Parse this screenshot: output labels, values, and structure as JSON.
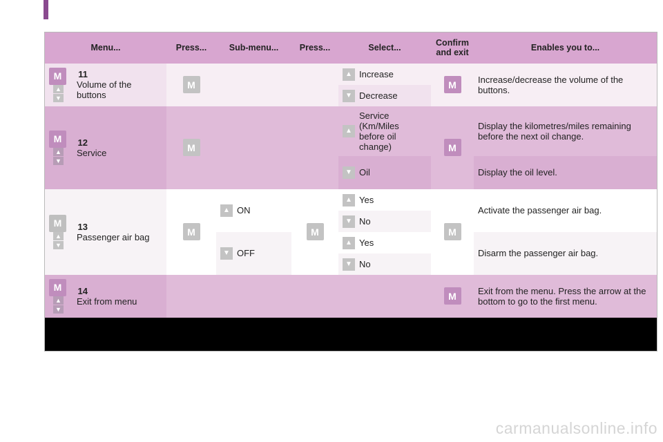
{
  "header": {
    "menu": "Menu...",
    "press1": "Press...",
    "submenu": "Sub-menu...",
    "press2": "Press...",
    "select": "Select...",
    "confirm": "Confirm and exit",
    "enables": "Enables you to..."
  },
  "btn_M": "M",
  "rows": {
    "r11": {
      "num": "11",
      "menu": "Volume of the buttons",
      "sel_up": "Increase",
      "sel_dn": "Decrease",
      "enables": "Increase/decrease the volume of the buttons."
    },
    "r12": {
      "num": "12",
      "menu": "Service",
      "sel_up": "Service (Km/Miles before oil change)",
      "sel_dn": "Oil",
      "enables_up": "Display the kilometres/miles remaining before the next oil change.",
      "enables_dn": "Display the oil level."
    },
    "r13": {
      "num": "13",
      "menu": "Passenger air bag",
      "sub_on": "ON",
      "sub_off": "OFF",
      "yes": "Yes",
      "no": "No",
      "enables_on": "Activate the passenger air bag.",
      "enables_off": "Disarm the passenger air bag."
    },
    "r14": {
      "num": "14",
      "menu": "Exit from menu",
      "enables": "Exit from the menu. Press the arrow at the bottom to go to the first menu."
    }
  },
  "watermark": "carmanualsonline.info"
}
